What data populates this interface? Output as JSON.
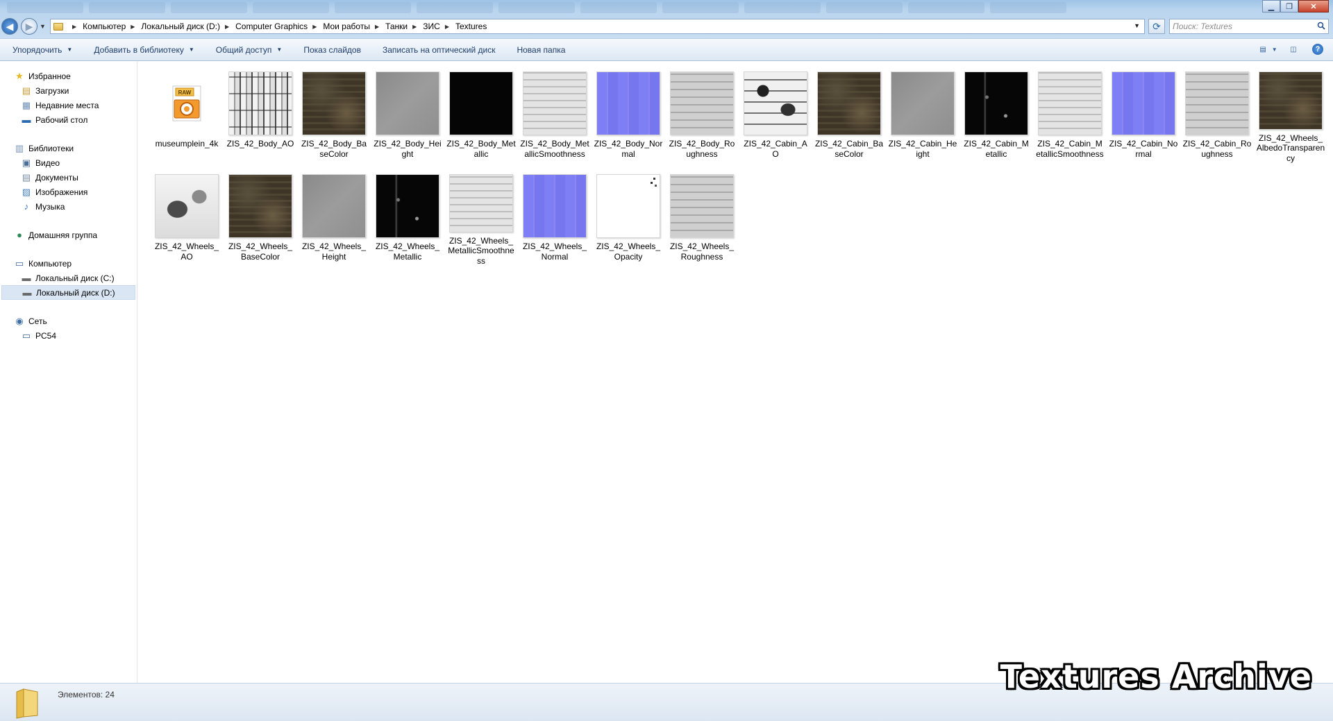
{
  "window": {
    "minimize": "▁",
    "maximize": "❐",
    "close": "✕"
  },
  "address": {
    "breadcrumbs": [
      "Компьютер",
      "Локальный диск (D:)",
      "Computer Graphics",
      "Мои работы",
      "Танки",
      "ЗИС",
      "Textures"
    ]
  },
  "search": {
    "placeholder": "Поиск: Textures"
  },
  "toolbar": {
    "organize": "Упорядочить",
    "add_to_library": "Добавить в библиотеку",
    "share": "Общий доступ",
    "slideshow": "Показ слайдов",
    "burn": "Записать на оптический диск",
    "new_folder": "Новая папка"
  },
  "nav": {
    "favorites": "Избранное",
    "downloads": "Загрузки",
    "recent": "Недавние места",
    "desktop": "Рабочий стол",
    "libraries": "Библиотеки",
    "video": "Видео",
    "documents": "Документы",
    "images": "Изображения",
    "music": "Музыка",
    "homegroup": "Домашняя группа",
    "computer": "Компьютер",
    "disk_c": "Локальный диск (C:)",
    "disk_d": "Локальный диск (D:)",
    "network": "Сеть",
    "pc": "PC54"
  },
  "files": [
    {
      "name": "museumplein_4k",
      "kind": "raw"
    },
    {
      "name": "ZIS_42_Body_AO",
      "kind": "ao"
    },
    {
      "name": "ZIS_42_Body_BaseColor",
      "kind": "base"
    },
    {
      "name": "ZIS_42_Body_Height",
      "kind": "height"
    },
    {
      "name": "ZIS_42_Body_Metallic",
      "kind": "metal"
    },
    {
      "name": "ZIS_42_Body_MetallicSmoothness",
      "kind": "smooth"
    },
    {
      "name": "ZIS_42_Body_Normal",
      "kind": "normal"
    },
    {
      "name": "ZIS_42_Body_Roughness",
      "kind": "rough"
    },
    {
      "name": "ZIS_42_Cabin_AO",
      "kind": "cab-ao"
    },
    {
      "name": "ZIS_42_Cabin_BaseColor",
      "kind": "base"
    },
    {
      "name": "ZIS_42_Cabin_Height",
      "kind": "height"
    },
    {
      "name": "ZIS_42_Cabin_Metallic",
      "kind": "metal2"
    },
    {
      "name": "ZIS_42_Cabin_MetallicSmoothness",
      "kind": "smooth"
    },
    {
      "name": "ZIS_42_Cabin_Normal",
      "kind": "normal"
    },
    {
      "name": "ZIS_42_Cabin_Roughness",
      "kind": "rough"
    },
    {
      "name": "ZIS_42_Wheels_AlbedoTransparency",
      "kind": "base"
    },
    {
      "name": "ZIS_42_Wheels_AO",
      "kind": "wheels-ao"
    },
    {
      "name": "ZIS_42_Wheels_BaseColor",
      "kind": "base"
    },
    {
      "name": "ZIS_42_Wheels_Height",
      "kind": "height"
    },
    {
      "name": "ZIS_42_Wheels_Metallic",
      "kind": "metal2"
    },
    {
      "name": "ZIS_42_Wheels_MetallicSmoothness",
      "kind": "smooth"
    },
    {
      "name": "ZIS_42_Wheels_Normal",
      "kind": "normal"
    },
    {
      "name": "ZIS_42_Wheels_Opacity",
      "kind": "opacity"
    },
    {
      "name": "ZIS_42_Wheels_Roughness",
      "kind": "rough"
    }
  ],
  "raw_badge": "RAW",
  "details": {
    "count": "Элементов: 24"
  },
  "watermark": "Textures Archive"
}
